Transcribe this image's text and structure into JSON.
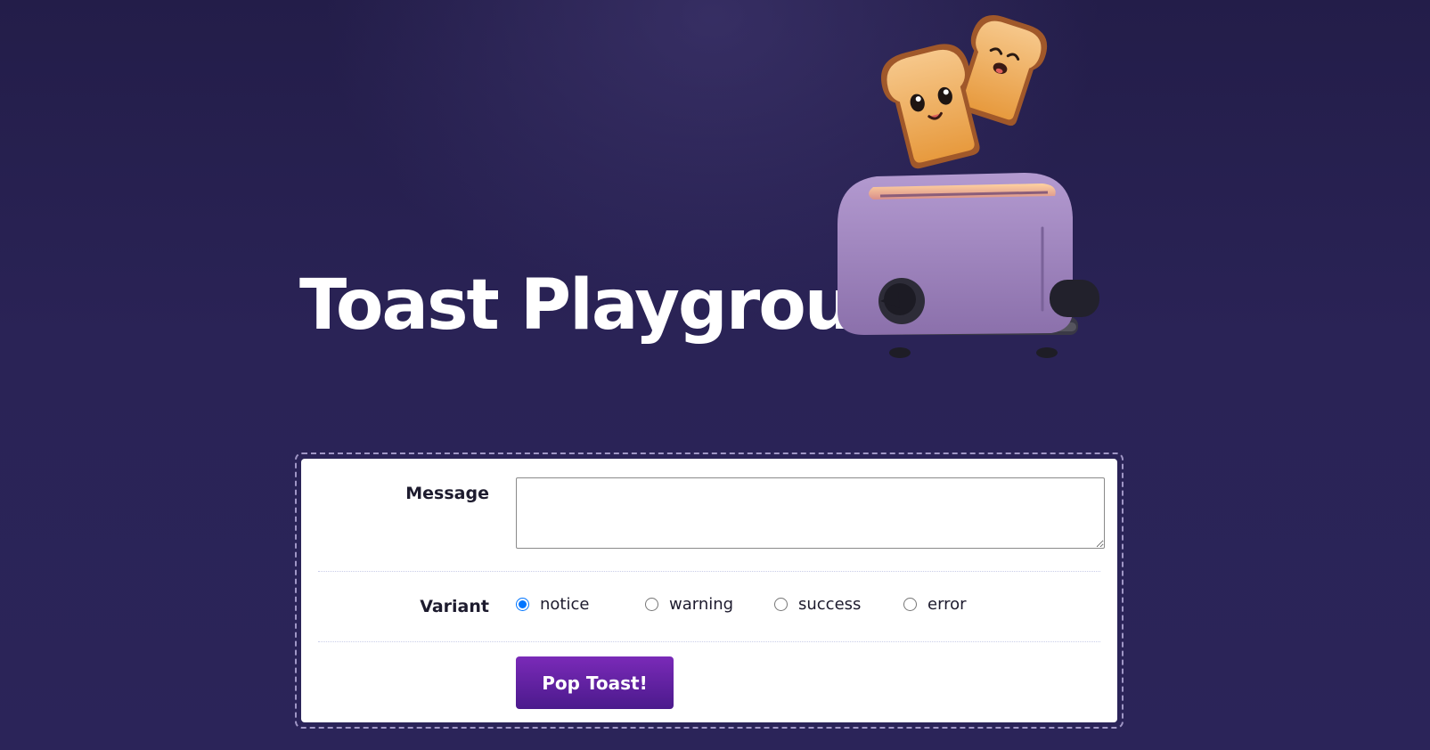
{
  "page": {
    "title": "Toast Playground"
  },
  "illustration": {
    "icon": "toaster-with-toast-icon"
  },
  "form": {
    "message_label": "Message",
    "message_value": "",
    "variant_label": "Variant",
    "variants": [
      {
        "label": "notice",
        "checked": true
      },
      {
        "label": "warning",
        "checked": false
      },
      {
        "label": "success",
        "checked": false
      },
      {
        "label": "error",
        "checked": false
      }
    ],
    "submit_label": "Pop Toast!"
  },
  "colors": {
    "background": "#2a2356",
    "button": "#6a24a8",
    "card": "#ffffff"
  }
}
